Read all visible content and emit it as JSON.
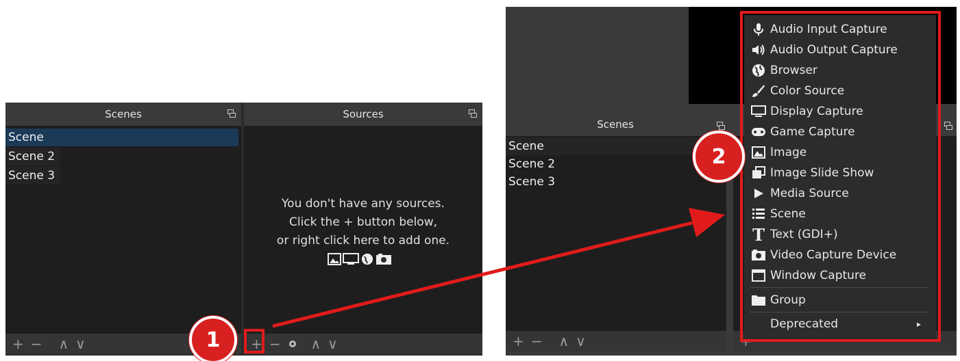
{
  "left": {
    "scenes_title": "Scenes",
    "scenes": [
      "Scene",
      "Scene 2",
      "Scene 3"
    ],
    "sources_title": "Sources",
    "empty_lines": [
      "You don't have any sources.",
      "Click the + button below,",
      "or right click here to add one."
    ],
    "toolbar": {
      "add": "+",
      "remove": "−",
      "up": "∧",
      "down": "∨"
    }
  },
  "right": {
    "scenes_title": "Scenes",
    "scenes": [
      "Scene",
      "Scene 2",
      "Scene 3"
    ]
  },
  "menu": {
    "items": [
      {
        "label": "Audio Input Capture",
        "icon": "microphone-icon"
      },
      {
        "label": "Audio Output Capture",
        "icon": "speaker-icon"
      },
      {
        "label": "Browser",
        "icon": "globe-icon"
      },
      {
        "label": "Color Source",
        "icon": "paint-brush-icon"
      },
      {
        "label": "Display Capture",
        "icon": "monitor-icon"
      },
      {
        "label": "Game Capture",
        "icon": "gamepad-icon"
      },
      {
        "label": "Image",
        "icon": "image-icon"
      },
      {
        "label": "Image Slide Show",
        "icon": "slideshow-icon"
      },
      {
        "label": "Media Source",
        "icon": "play-icon"
      },
      {
        "label": "Scene",
        "icon": "list-icon"
      },
      {
        "label": "Text (GDI+)",
        "icon": "text-icon"
      },
      {
        "label": "Video Capture Device",
        "icon": "camera-icon"
      },
      {
        "label": "Window Capture",
        "icon": "window-icon"
      }
    ],
    "group": "Group",
    "deprecated": "Deprecated",
    "submenu_arrow": "▸"
  },
  "annotations": {
    "step1": "1",
    "step2": "2",
    "accent": "#e11b1b"
  }
}
